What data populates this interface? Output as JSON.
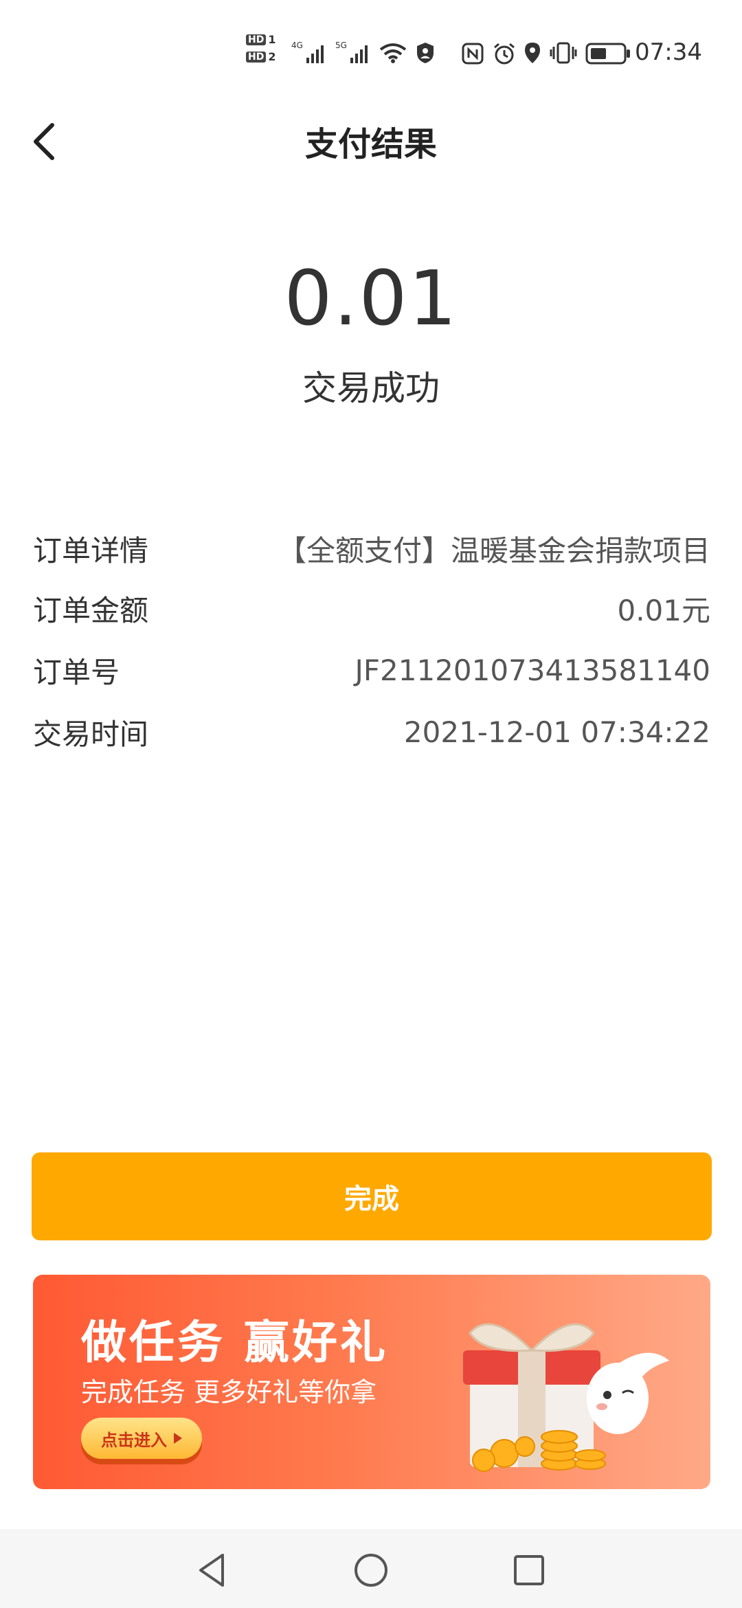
{
  "status_bar": {
    "hd1": "HD",
    "hd1_num": "1",
    "hd2": "HD",
    "hd2_num": "2",
    "net1": "4G",
    "net2": "5G",
    "time": "07:34"
  },
  "header": {
    "title": "支付结果"
  },
  "result": {
    "amount": "0.01",
    "status": "交易成功"
  },
  "details": [
    {
      "label": "订单详情",
      "value": "【全额支付】温暖基金会捐款项目"
    },
    {
      "label": "订单金额",
      "value": "0.01元"
    },
    {
      "label": "订单号",
      "value": "JF211201073413581140"
    },
    {
      "label": "交易时间",
      "value": "2021-12-01 07:34:22"
    }
  ],
  "done_button": {
    "label": "完成",
    "color": "#FFA800"
  },
  "promo": {
    "title": "做任务 赢好礼",
    "subtitle": "完成任务 更多好礼等你拿",
    "cta": "点击进入",
    "colors": {
      "start": "#FF5A34",
      "end": "#FFA987"
    }
  },
  "icons": {
    "back": "chevron-left-icon",
    "nav_back": "triangle-back-icon",
    "nav_home": "circle-home-icon",
    "nav_recent": "square-recent-icon"
  }
}
